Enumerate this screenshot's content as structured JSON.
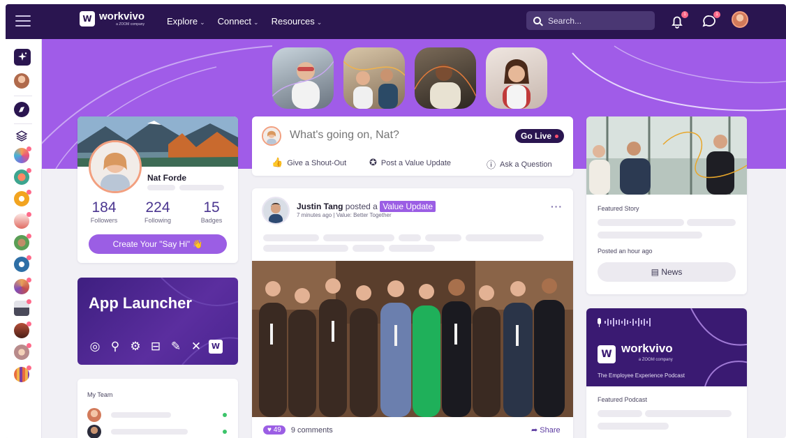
{
  "nav": {
    "logo_text": "workvivo",
    "logo_sub": "a ZOOM company",
    "items": [
      {
        "label": "Explore"
      },
      {
        "label": "Connect"
      },
      {
        "label": "Resources"
      }
    ],
    "search_placeholder": "Search...",
    "notifications_badge": "1",
    "messages_badge": "1"
  },
  "profile": {
    "name": "Nat Forde",
    "followers": "184",
    "followers_label": "Followers",
    "following": "224",
    "following_label": "Following",
    "badges": "15",
    "badges_label": "Badges",
    "say_hi_label": "Create Your \"Say Hi\" 👋"
  },
  "app_launcher": {
    "title": "App Launcher",
    "icons": [
      "chrome-icon",
      "search-icon",
      "gear-icon",
      "briefcase-icon",
      "edit-icon",
      "tools-icon",
      "workvivo-icon"
    ]
  },
  "my_team": {
    "title": "My Team"
  },
  "composer": {
    "placeholder": "What's going on, Nat?",
    "go_live": "Go Live",
    "actions": [
      {
        "label": "Give a Shout-Out",
        "icon": "thumbs-up-icon"
      },
      {
        "label": "Post a Value Update",
        "icon": "value-icon"
      },
      {
        "label": "Ask a Question",
        "icon": "question-icon"
      }
    ]
  },
  "post": {
    "author": "Justin Tang",
    "verb": "posted a",
    "badge": "Value Update",
    "meta": "7 minutes ago | Value: Better Together",
    "likes": "49",
    "comments": "9 comments",
    "share": "Share"
  },
  "featured_story": {
    "label": "Featured Story",
    "posted": "Posted an hour ago",
    "button": "News"
  },
  "podcast": {
    "logo_text": "workvivo",
    "logo_sub": "a ZOOM company",
    "subtitle": "The Employee Experience Podcast",
    "label": "Featured Podcast"
  },
  "colors": {
    "nav_bg": "#2a1550",
    "hero_bg": "#a05ce8",
    "accent": "#9b5ee4",
    "launcher_bg": "#3e1f80"
  }
}
